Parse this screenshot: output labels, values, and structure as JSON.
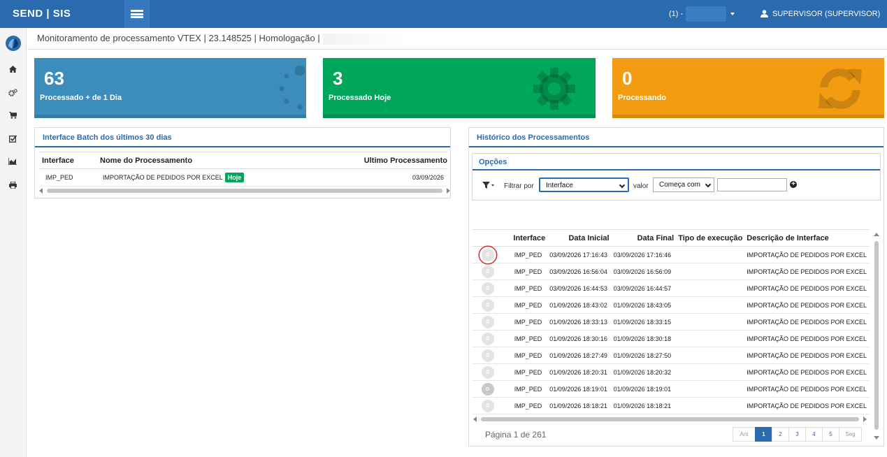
{
  "app": {
    "brand": "SEND | SIS",
    "tenant_label": "(1) -",
    "user_label": "SUPERVISOR (SUPERVISOR)"
  },
  "page": {
    "title": "Monitoramento de processamento VTEX | 23.148525 | Homologação |"
  },
  "sidebar": {
    "items": [
      {
        "icon": "home-icon"
      },
      {
        "icon": "cogs-icon"
      },
      {
        "icon": "cart-icon"
      },
      {
        "icon": "checkbox-icon"
      },
      {
        "icon": "chart-icon"
      },
      {
        "icon": "print-icon"
      }
    ]
  },
  "tiles": [
    {
      "value": "63",
      "label": "Processado + de 1 Dia",
      "color": "#3c8dbc",
      "icon": "spinner-icon"
    },
    {
      "value": "3",
      "label": "Processado Hoje",
      "color": "#00a65a",
      "icon": "gear-icon"
    },
    {
      "value": "0",
      "label": "Processando",
      "color": "#f39c12",
      "icon": "refresh-icon"
    }
  ],
  "batch_panel": {
    "title": "Interface Batch dos últimos 30 dias",
    "headers": [
      "Interface",
      "Nome do Processamento",
      "Ultimo Processamento"
    ],
    "rows": [
      {
        "interface": "IMP_PED",
        "name": "IMPORTAÇÃO DE PEDIDOS POR EXCEL",
        "badge": "Hoje",
        "last": "03/09/2026"
      }
    ]
  },
  "history_panel": {
    "title": "Histórico dos Processamentos",
    "options_title": "Opções",
    "filter_label": "Filtrar por",
    "filter_selected": "Interface",
    "value_label": "valor",
    "match_selected": "Começa com",
    "value_input": "",
    "headers": [
      "",
      "Interface",
      "Data Inicial",
      "Data Final",
      "Tipo de execução",
      "Descrição de Interface"
    ],
    "rows": [
      {
        "interface": "IMP_PED",
        "start": "03/09/2026 17:16:43",
        "end": "03/09/2026 17:16:46",
        "type": "",
        "desc": "IMPORTAÇÃO DE PEDIDOS POR EXCEL"
      },
      {
        "interface": "IMP_PED",
        "start": "03/09/2026 16:56:04",
        "end": "03/09/2026 16:56:09",
        "type": "",
        "desc": "IMPORTAÇÃO DE PEDIDOS POR EXCEL"
      },
      {
        "interface": "IMP_PED",
        "start": "03/09/2026 16:44:53",
        "end": "03/09/2026 16:44:57",
        "type": "",
        "desc": "IMPORTAÇÃO DE PEDIDOS POR EXCEL"
      },
      {
        "interface": "IMP_PED",
        "start": "01/09/2026 18:43:02",
        "end": "01/09/2026 18:43:05",
        "type": "",
        "desc": "IMPORTAÇÃO DE PEDIDOS POR EXCEL"
      },
      {
        "interface": "IMP_PED",
        "start": "01/09/2026 18:33:13",
        "end": "01/09/2026 18:33:15",
        "type": "",
        "desc": "IMPORTAÇÃO DE PEDIDOS POR EXCEL"
      },
      {
        "interface": "IMP_PED",
        "start": "01/09/2026 18:30:16",
        "end": "01/09/2026 18:30:18",
        "type": "",
        "desc": "IMPORTAÇÃO DE PEDIDOS POR EXCEL"
      },
      {
        "interface": "IMP_PED",
        "start": "01/09/2026 18:27:49",
        "end": "01/09/2026 18:27:50",
        "type": "",
        "desc": "IMPORTAÇÃO DE PEDIDOS POR EXCEL"
      },
      {
        "interface": "IMP_PED",
        "start": "01/09/2026 18:20:31",
        "end": "01/09/2026 18:20:32",
        "type": "",
        "desc": "IMPORTAÇÃO DE PEDIDOS POR EXCEL"
      },
      {
        "interface": "IMP_PED",
        "start": "01/09/2026 18:19:01",
        "end": "01/09/2026 18:19:01",
        "type": "",
        "desc": "IMPORTAÇÃO DE PEDIDOS POR EXCEL"
      },
      {
        "interface": "IMP_PED",
        "start": "01/09/2026 18:18:21",
        "end": "01/09/2026 18:18:21",
        "type": "",
        "desc": "IMPORTAÇÃO DE PEDIDOS POR EXCEL"
      }
    ],
    "page_info": "Página 1 de 261",
    "pager": {
      "prev": "Ant",
      "pages": [
        "1",
        "2",
        "3",
        "4",
        "5"
      ],
      "next": "Seg",
      "active": "1"
    }
  }
}
